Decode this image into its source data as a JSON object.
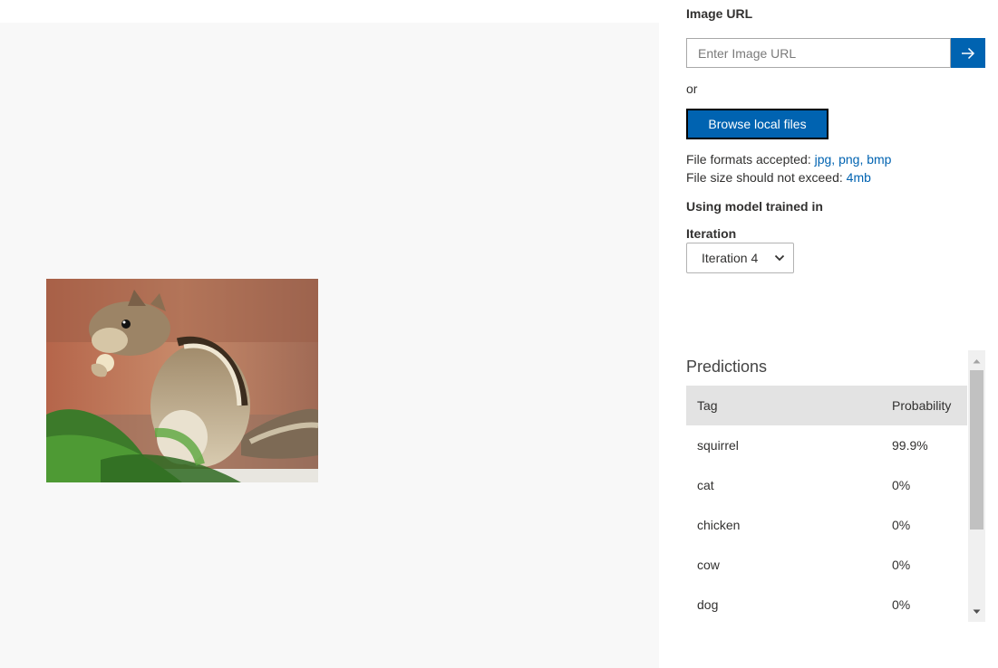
{
  "preview": {
    "image_icon": "squirrel-photo"
  },
  "image_url": {
    "label": "Image URL",
    "placeholder": "Enter Image URL",
    "submit_icon": "arrow-right-icon"
  },
  "or_text": "or",
  "browse_button": "Browse local files",
  "file_formats": {
    "prefix": "File formats accepted:",
    "value": "jpg, png, bmp"
  },
  "file_size": {
    "prefix": "File size should not exceed:",
    "value": "4mb"
  },
  "model_label": "Using model trained in",
  "iteration": {
    "label": "Iteration",
    "selected": "Iteration 4"
  },
  "predictions": {
    "title": "Predictions",
    "columns": [
      "Tag",
      "Probability"
    ],
    "rows": [
      {
        "tag": "squirrel",
        "probability": "99.9%"
      },
      {
        "tag": "cat",
        "probability": "0%"
      },
      {
        "tag": "chicken",
        "probability": "0%"
      },
      {
        "tag": "cow",
        "probability": "0%"
      },
      {
        "tag": "dog",
        "probability": "0%"
      }
    ]
  },
  "colors": {
    "accent": "#0063b1",
    "preview_bg": "#f8f8f8",
    "table_header_bg": "#e3e3e3"
  }
}
